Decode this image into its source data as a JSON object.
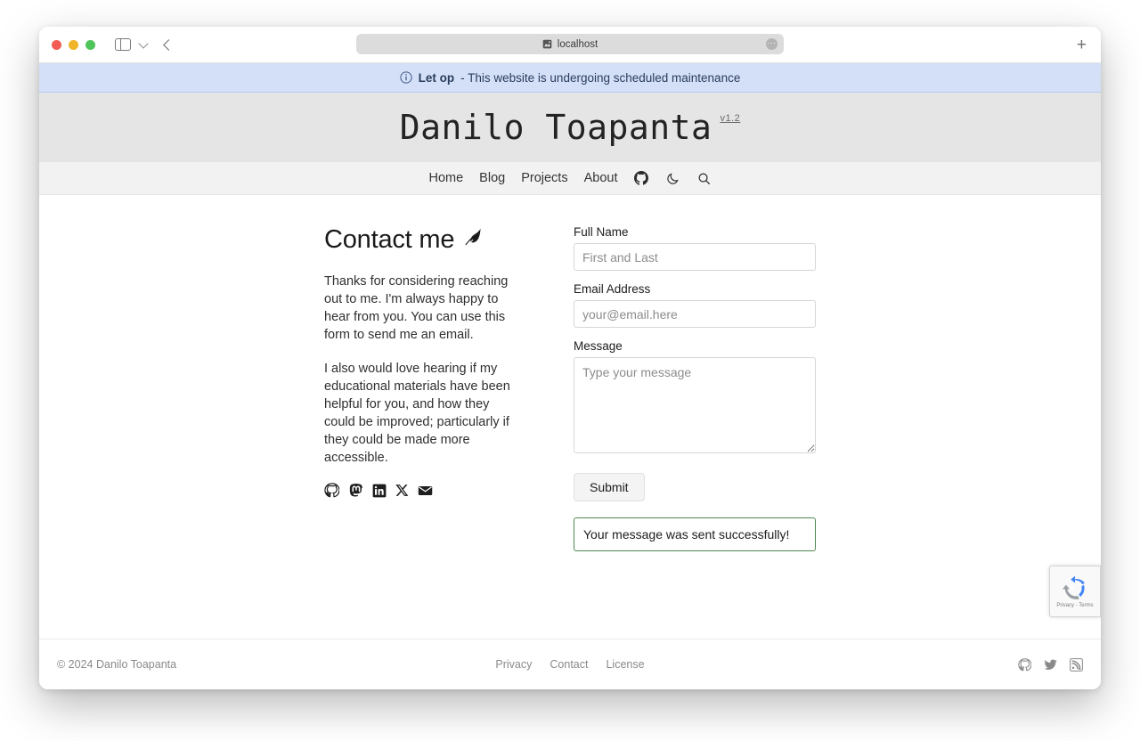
{
  "browser": {
    "url_text": "localhost",
    "favicon_name": "site-favicon",
    "new_tab_label": "+",
    "more_label": "···"
  },
  "banner": {
    "icon": "info-circle-icon",
    "strong": "Let op",
    "rest": " - This website is undergoing scheduled maintenance",
    "background_color": "#d3e0f7",
    "text_color": "#2b3c5e"
  },
  "header": {
    "title": "Danilo Toapanta",
    "version": "v1.2",
    "background_color": "#e5e5e5"
  },
  "nav": {
    "links": [
      {
        "label": "Home"
      },
      {
        "label": "Blog"
      },
      {
        "label": "Projects"
      },
      {
        "label": "About"
      }
    ],
    "icons": [
      {
        "name": "github-icon"
      },
      {
        "name": "moon-dark-mode-icon"
      },
      {
        "name": "search-icon"
      }
    ]
  },
  "main": {
    "page_title": "Contact me",
    "title_icon": "quill-feather-icon",
    "paragraph_1": "Thanks for considering reaching out to me. I'm always happy to hear from you. You can use this form to send me an email.",
    "paragraph_2": "I also would love hearing if my educational materials have been helpful for you, and how they could be improved; particularly if they could be made more accessible.",
    "social": [
      {
        "name": "github-icon"
      },
      {
        "name": "mastodon-icon"
      },
      {
        "name": "linkedin-icon"
      },
      {
        "name": "x-twitter-icon"
      },
      {
        "name": "email-envelope-icon"
      }
    ]
  },
  "form": {
    "full_name": {
      "label": "Full Name",
      "placeholder": "First and Last",
      "value": ""
    },
    "email": {
      "label": "Email Address",
      "placeholder": "your@email.here",
      "value": ""
    },
    "message": {
      "label": "Message",
      "placeholder": "Type your message",
      "value": ""
    },
    "submit_label": "Submit",
    "success_message": "Your message was sent successfully!",
    "success_border_color": "#4f8a52"
  },
  "recaptcha": {
    "name": "recaptcha-badge",
    "terms_text": "Privacy - Terms"
  },
  "footer": {
    "copyright": "© 2024 Danilo Toapanta",
    "links": [
      {
        "label": "Privacy"
      },
      {
        "label": "Contact"
      },
      {
        "label": "License"
      }
    ],
    "icons": [
      {
        "name": "github-icon"
      },
      {
        "name": "twitter-icon"
      },
      {
        "name": "rss-feed-icon"
      }
    ]
  }
}
